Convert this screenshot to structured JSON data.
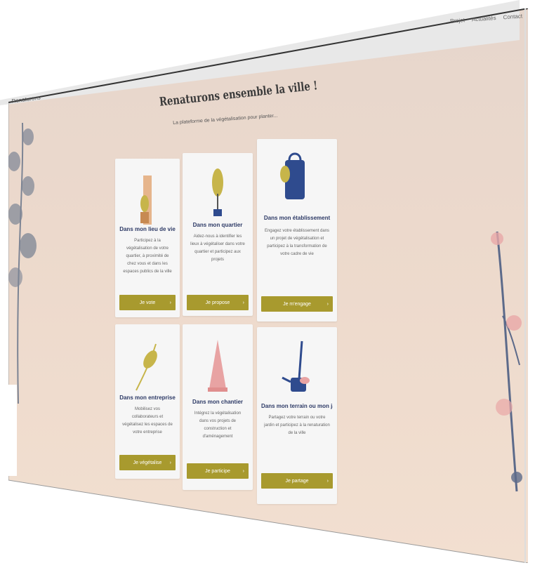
{
  "header": {
    "brand": "Renaturons",
    "links": [
      "Projet",
      "Actualités",
      "Contact"
    ]
  },
  "hero": {
    "title": "Renaturons ensemble la ville !",
    "subtitle": "La plateforme de la végétalisation pour planter..."
  },
  "cards": [
    {
      "title": "Dans mon lieu de vie",
      "desc": "Participez à la végétalisation de votre quartier, à proximité de chez vous et dans les espaces publics de la ville",
      "button": "Je vote"
    },
    {
      "title": "Dans mon quartier",
      "desc": "Aidez-nous à identifier les lieux à végétaliser dans votre quartier et participez aux projets",
      "button": "Je propose"
    },
    {
      "title": "Dans mon établissement",
      "desc": "Engagez votre établissement dans un projet de végétalisation et participez à la transformation de votre cadre de vie",
      "button": "Je m'engage"
    },
    {
      "title": "Dans mon entreprise",
      "desc": "Mobilisez vos collaborateurs et végétalisez les espaces de votre entreprise",
      "button": "Je végétalise"
    },
    {
      "title": "Dans mon chantier",
      "desc": "Intégrez la végétalisation dans vos projets de construction et d'aménagement",
      "button": "Je participe"
    },
    {
      "title": "Dans mon terrain ou mon jardin",
      "desc": "Partagez votre terrain ou votre jardin et participez à la renaturation de la ville",
      "button": "Je partage"
    }
  ],
  "colors": {
    "background": "#ecd9cc",
    "accent": "#a89a2e",
    "card_title": "#2d3a66"
  }
}
